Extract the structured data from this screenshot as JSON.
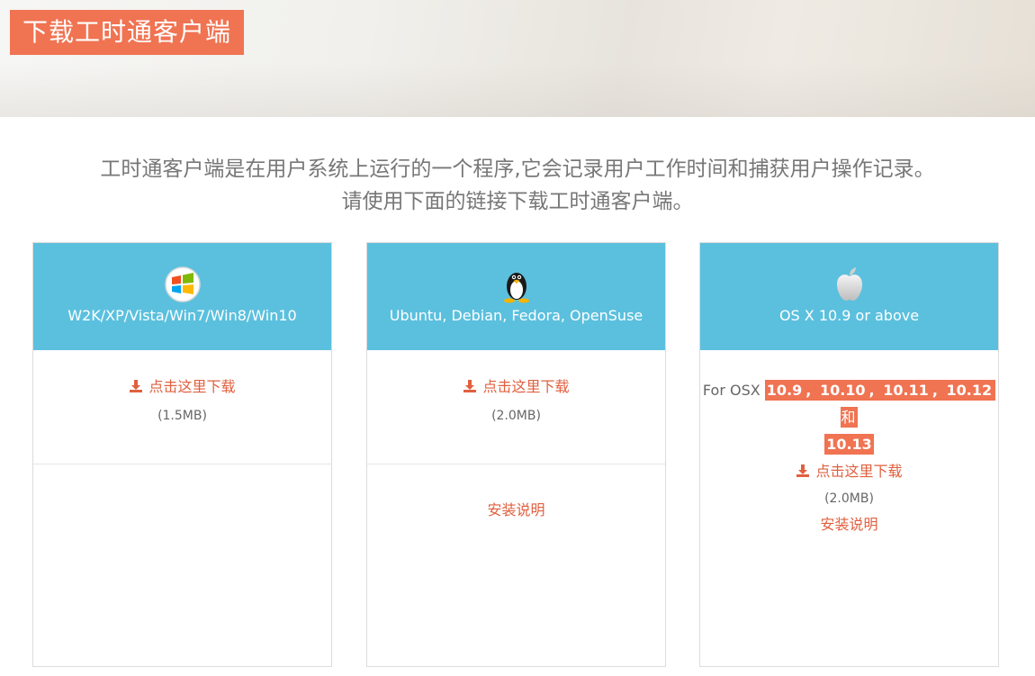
{
  "header": {
    "title": "下载工时通客户端"
  },
  "intro": {
    "line1": "工时通客户端是在用户系统上运行的一个程序,它会记录用户工作时间和捕获用户操作记录。",
    "line2": "请使用下面的链接下载工时通客户端。"
  },
  "cards": [
    {
      "os_icon": "windows-logo-icon",
      "os_label": "W2K/XP/Vista/Win7/Win8/Win10",
      "download_label": "点击这里下载",
      "size": "(1.5MB)"
    },
    {
      "os_icon": "linux-tux-icon",
      "os_label": "Ubuntu, Debian, Fedora, OpenSuse",
      "download_label": "点击这里下载",
      "size": "(2.0MB)",
      "install_label": "安装说明"
    },
    {
      "os_icon": "apple-logo-icon",
      "os_label": "OS X 10.9 or above",
      "for_prefix": "For OSX ",
      "versions": [
        "10.9",
        "10.10",
        "10.11",
        "10.12"
      ],
      "sep": ", ",
      "and_word": " 和 ",
      "last_version": "10.13",
      "download_label": "点击这里下载",
      "size": "(2.0MB)",
      "install_label": "安装说明"
    }
  ],
  "colors": {
    "accent": "#f07352",
    "link": "#e0603f",
    "card_header": "#5bc0de"
  }
}
